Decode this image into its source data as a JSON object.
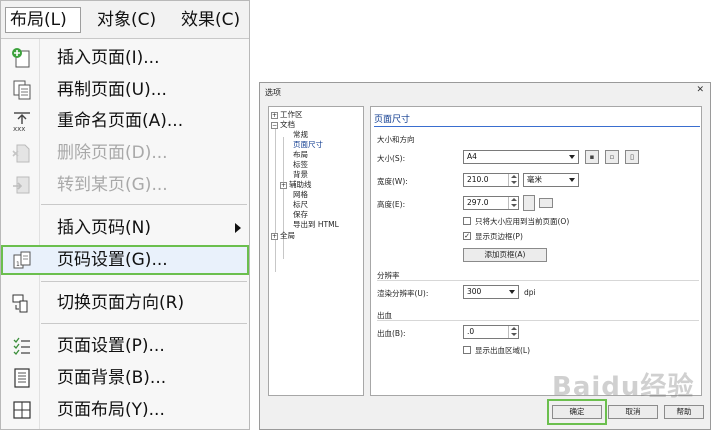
{
  "menubar": [
    {
      "label": "布局(L)",
      "active": true
    },
    {
      "label": "对象(C)"
    },
    {
      "label": "效果(C)"
    }
  ],
  "menu_items": [
    {
      "label": "插入页面(I)...",
      "icon": "insert-page-icon",
      "disabled": false
    },
    {
      "label": "再制页面(U)...",
      "icon": "duplicate-page-icon",
      "disabled": false
    },
    {
      "label": "重命名页面(A)...",
      "icon": "rename-page-icon",
      "disabled": false
    },
    {
      "label": "删除页面(D)...",
      "icon": "delete-page-icon",
      "disabled": true
    },
    {
      "label": "转到某页(G)...",
      "icon": "go-to-page-icon",
      "disabled": true
    },
    {
      "label": "插入页码(N)",
      "icon": "",
      "disabled": false,
      "submenu": true
    },
    {
      "label": "页码设置(G)...",
      "icon": "page-number-settings-icon",
      "disabled": false,
      "highlighted": true
    },
    {
      "label": "切换页面方向(R)",
      "icon": "switch-orientation-icon",
      "disabled": false
    },
    {
      "label": "页面设置(P)...",
      "icon": "page-setup-icon",
      "disabled": false
    },
    {
      "label": "页面背景(B)...",
      "icon": "page-background-icon",
      "disabled": false
    },
    {
      "label": "页面布局(Y)...",
      "icon": "page-layout-icon",
      "disabled": false
    }
  ],
  "dialog": {
    "title": "选项",
    "close": "✕",
    "tree": [
      {
        "label": "工作区",
        "level": 0,
        "expander": "+"
      },
      {
        "label": "文档",
        "level": 0,
        "expander": "−"
      },
      {
        "label": "常规",
        "level": 1
      },
      {
        "label": "页面尺寸",
        "level": 1
      },
      {
        "label": "布局",
        "level": 1
      },
      {
        "label": "标签",
        "level": 1
      },
      {
        "label": "背景",
        "level": 1
      },
      {
        "label": "辅助线",
        "level": 1,
        "expander": "+"
      },
      {
        "label": "网格",
        "level": 1
      },
      {
        "label": "标尺",
        "level": 1
      },
      {
        "label": "保存",
        "level": 1
      },
      {
        "label": "导出到 HTML",
        "level": 1
      },
      {
        "label": "全局",
        "level": 0,
        "expander": "+"
      }
    ],
    "header": "页面尺寸",
    "section_size": "大小和方向",
    "size_label": "大小(S):",
    "size_value": "A4",
    "width_label": "宽度(W):",
    "width_value": "210.0",
    "unit_value": "毫米",
    "height_label": "高度(E):",
    "height_value": "297.0",
    "apply_current_label": "只将大小应用到当前页面(O)",
    "show_border_label": "显示页边框(P)",
    "add_frame_label": "添加页框(A)",
    "section_resolution": "分辨率",
    "render_res_label": "渲染分辨率(U):",
    "render_res_value": "300",
    "dpi_unit": "dpi",
    "section_bleed": "出血",
    "bleed_label": "出血(B):",
    "bleed_value": ".0",
    "show_bleed_label": "显示出血区域(L)",
    "ok": "确定",
    "cancel": "取消",
    "help": "帮助"
  },
  "watermark": "Baidu经验"
}
